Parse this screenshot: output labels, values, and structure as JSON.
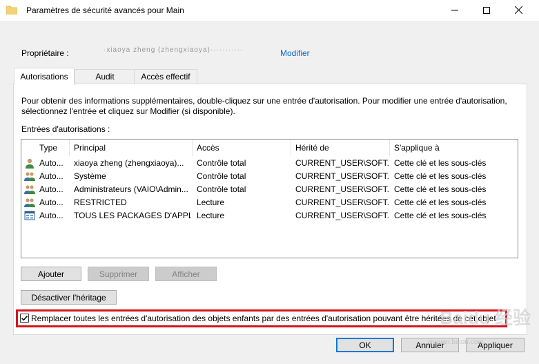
{
  "window": {
    "title": "Paramètres de sécurité avancés pour Main"
  },
  "owner": {
    "label": "Propriétaire :",
    "value": "·xiaoya zheng (zhengxiaoya)···········",
    "change_link": "Modifier"
  },
  "tabs": [
    {
      "label": "Autorisations",
      "active": true
    },
    {
      "label": "Audit",
      "active": false
    },
    {
      "label": "Accès effectif",
      "active": false
    }
  ],
  "description": "Pour obtenir des informations supplémentaires, double-cliquez sur une entrée d'autorisation. Pour modifier une entrée d'autorisation, sélectionnez l'entrée et cliquez sur Modifier (si disponible).",
  "entries_label": "Entrées d'autorisations :",
  "table": {
    "columns": [
      "Type",
      "Principal",
      "Accès",
      "Hérité de",
      "S'applique à"
    ],
    "rows": [
      {
        "icon": "user-icon",
        "type": "Auto...",
        "principal": "xiaoya zheng (zhengxiaoya)...",
        "access": "Contrôle total",
        "inherited": "CURRENT_USER\\SOFT...",
        "applies": "Cette clé et les sous-clés"
      },
      {
        "icon": "group-icon",
        "type": "Auto...",
        "principal": "Système",
        "access": "Contrôle total",
        "inherited": "CURRENT_USER\\SOFT...",
        "applies": "Cette clé et les sous-clés"
      },
      {
        "icon": "group-icon",
        "type": "Auto...",
        "principal": "Administrateurs (VAIO\\Admin...",
        "access": "Contrôle total",
        "inherited": "CURRENT_USER\\SOFT...",
        "applies": "Cette clé et les sous-clés"
      },
      {
        "icon": "group-icon",
        "type": "Auto...",
        "principal": "RESTRICTED",
        "access": "Lecture",
        "inherited": "CURRENT_USER\\SOFT...",
        "applies": "Cette clé et les sous-clés"
      },
      {
        "icon": "app-package-icon",
        "type": "Auto...",
        "principal": "TOUS LES PACKAGES D'APPLI...",
        "access": "Lecture",
        "inherited": "CURRENT_USER\\SOFT...",
        "applies": "Cette clé et les sous-clés"
      }
    ]
  },
  "buttons": {
    "add": "Ajouter",
    "remove": "Supprimer",
    "view": "Afficher",
    "disable_inheritance": "Désactiver l'héritage",
    "ok": "OK",
    "cancel": "Annuler",
    "apply": "Appliquer"
  },
  "replace_checkbox": {
    "label": "Remplacer toutes les entrées d'autorisation des objets enfants par des entrées d'autorisation pouvant être héritées de cet objet",
    "checked": true
  },
  "watermark": {
    "logo": "Baidu 经验",
    "url": "jingyan.baidu.com"
  },
  "colors": {
    "highlight_border": "#d4141c",
    "link": "#0066cc",
    "default_button_border": "#0078d7"
  }
}
